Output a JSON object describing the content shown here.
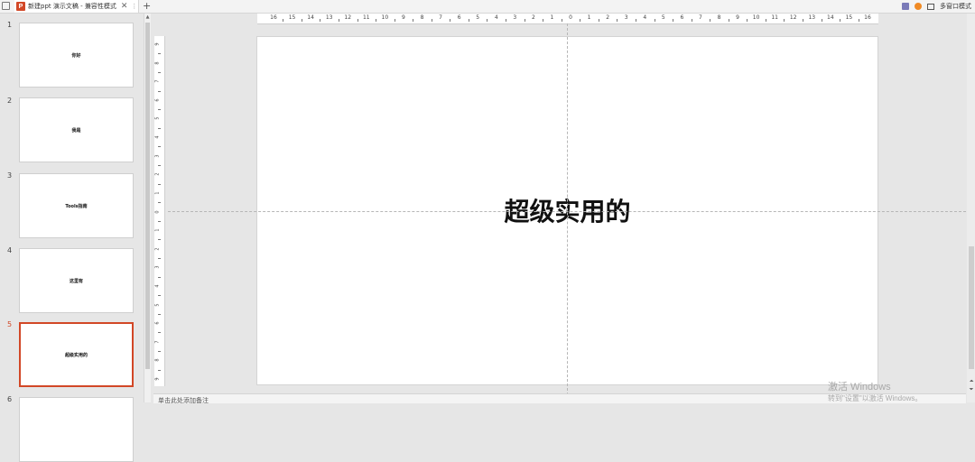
{
  "tabbar": {
    "tab_title": "新建ppt 演示文稿 - 兼容性模式",
    "close_glyph": "✕",
    "more_glyph": "⋮",
    "plus_glyph": "+",
    "multi_window_label": "多窗口模式"
  },
  "slides": [
    {
      "number": "1",
      "title": "你好"
    },
    {
      "number": "2",
      "title": "我是"
    },
    {
      "number": "3",
      "title": "Tools指南"
    },
    {
      "number": "4",
      "title": "这里有"
    },
    {
      "number": "5",
      "title": "超级实用的"
    },
    {
      "number": "6",
      "title": ""
    }
  ],
  "active_slide": 5,
  "ruler": {
    "horizontal": [
      "16",
      "15",
      "14",
      "13",
      "12",
      "11",
      "10",
      "9",
      "8",
      "7",
      "6",
      "5",
      "4",
      "3",
      "2",
      "1",
      "0",
      "1",
      "2",
      "3",
      "4",
      "5",
      "6",
      "7",
      "8",
      "9",
      "10",
      "11",
      "12",
      "13",
      "14",
      "15",
      "16"
    ],
    "vertical": [
      "9",
      "8",
      "7",
      "6",
      "5",
      "4",
      "3",
      "2",
      "1",
      "0",
      "1",
      "2",
      "3",
      "4",
      "5",
      "6",
      "7",
      "8",
      "9"
    ]
  },
  "current_slide": {
    "title": "超级实用的"
  },
  "notes": {
    "placeholder": "单击此处添加备注"
  },
  "watermark": {
    "line1": "激活 Windows",
    "line2": "转到\"设置\"以激活 Windows。"
  },
  "colors": {
    "accent": "#d24726",
    "background": "#e6e6e6"
  }
}
